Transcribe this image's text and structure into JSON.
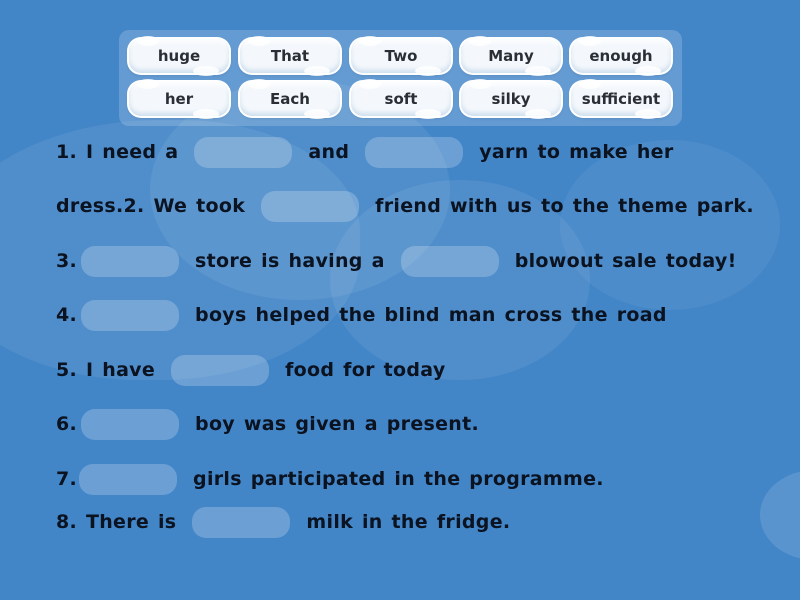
{
  "word_bank": {
    "row1": [
      "huge",
      "That",
      "Two",
      "Many",
      "enough"
    ],
    "row2": [
      "her",
      "Each",
      "soft",
      "silky",
      "sufficient"
    ]
  },
  "sentences": {
    "s1": {
      "a": "1. I need a",
      "b": "and",
      "c": "yarn to make her"
    },
    "s2": {
      "a": "dress.2. We took",
      "b": "friend with us to the theme park."
    },
    "s3": {
      "a": "3.",
      "b": "store is having a",
      "c": "blowout sale today!"
    },
    "s4": {
      "a": "4.",
      "b": "boys helped the blind man cross the road"
    },
    "s5": {
      "a": "5. I have",
      "b": "food for today"
    },
    "s6": {
      "a": "6.",
      "b": "boy was given a present."
    },
    "s7": {
      "a": "7.",
      "b": "girls participated in the programme."
    },
    "s8": {
      "a": "8. There is",
      "b": "milk in the fridge."
    }
  },
  "colors": {
    "background": "#4386c8",
    "tile": "#f4f8fc",
    "text": "#0b1220"
  }
}
